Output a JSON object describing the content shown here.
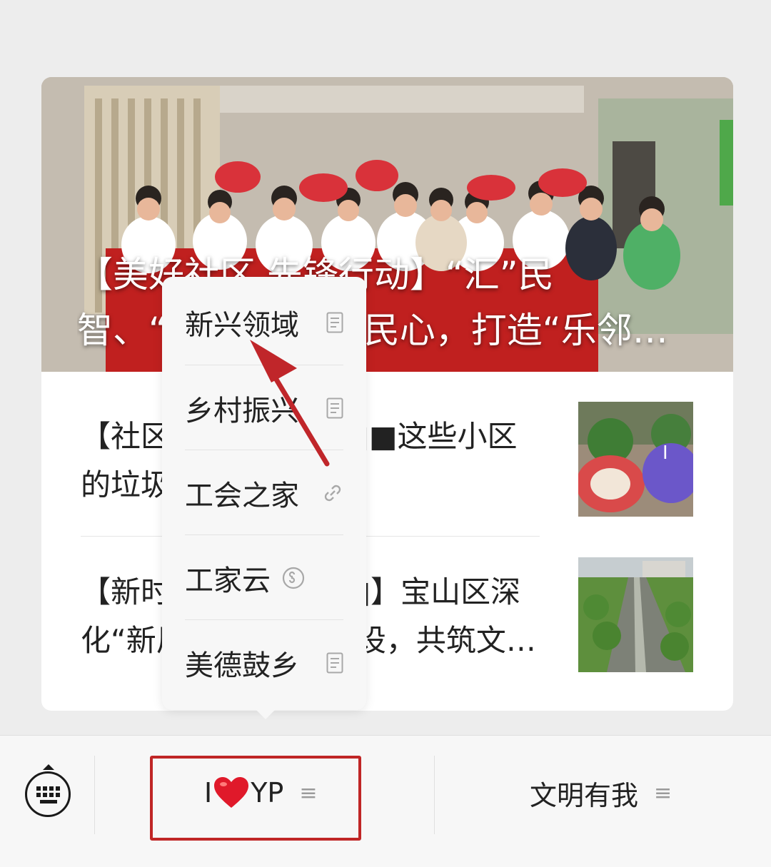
{
  "feed": {
    "hero_title": "【美好社区 先锋行动】“汇”民智、“惠”民生，暖民心，打造“乐邻…",
    "articles": [
      {
        "title": "【社区■■■■■■■■这些小区的垃圾厢房■■"
      },
      {
        "title": "【新时代■■■■■■】宝山区深化“新风■■■■■■设，共筑文…"
      }
    ]
  },
  "submenu": {
    "items": [
      {
        "label": "新兴领域",
        "icon": "article-icon"
      },
      {
        "label": "乡村振兴",
        "icon": "article-icon"
      },
      {
        "label": "工会之家",
        "icon": "link-icon"
      },
      {
        "label": "工家云",
        "icon": "mini-program-icon"
      },
      {
        "label": "美德鼓乡",
        "icon": "article-icon"
      }
    ]
  },
  "bottom_menu": {
    "tab1": {
      "prefix": "I",
      "heart": "❤️",
      "suffix": "YP"
    },
    "tab2": {
      "label": "文明有我"
    }
  },
  "colors": {
    "highlight": "#c02626",
    "annotation_arrow": "#c0262a"
  }
}
